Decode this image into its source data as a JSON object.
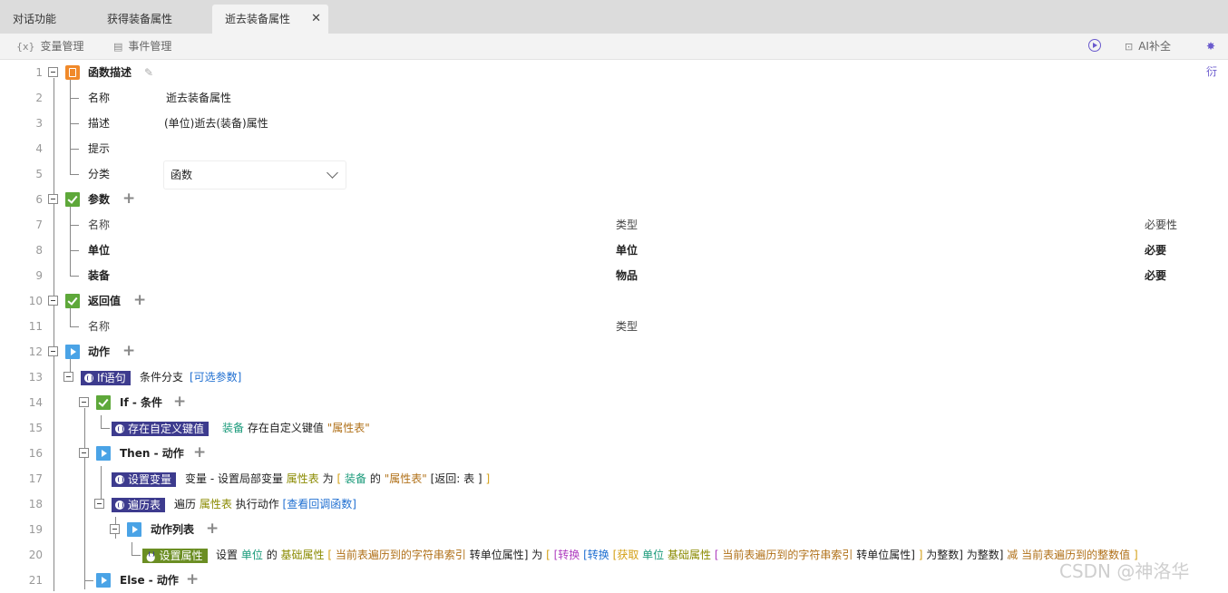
{
  "tabs": [
    "对话功能",
    "获得装备属性",
    "逝去装备属性"
  ],
  "tab_close": "✕",
  "toolbar": {
    "var_icon": "{x}",
    "var_label": "变量管理",
    "event_label": "事件管理",
    "ai_label": "AI补全",
    "cut_label": "衍"
  },
  "lines": [
    "1",
    "2",
    "3",
    "4",
    "5",
    "6",
    "7",
    "8",
    "9",
    "10",
    "11",
    "12",
    "13",
    "14",
    "15",
    "16",
    "17",
    "18",
    "19",
    "20",
    "21"
  ],
  "desc": {
    "header": "函数描述",
    "name_label": "名称",
    "name_value": "逝去装备属性",
    "desc_label": "描述",
    "desc_value": "(单位)逝去(装备)属性",
    "hint_label": "提示",
    "category_label": "分类",
    "category_value": "函数"
  },
  "params": {
    "header": "参数",
    "col_name": "名称",
    "col_type": "类型",
    "col_required": "必要性",
    "rows": [
      {
        "name": "单位",
        "type": "单位",
        "required": "必要"
      },
      {
        "name": "装备",
        "type": "物品",
        "required": "必要"
      }
    ]
  },
  "returns": {
    "header": "返回值",
    "col_name": "名称",
    "col_type": "类型"
  },
  "actions": {
    "header": "动作",
    "if_badge": "If语句",
    "if_desc": "条件分支",
    "if_opt": "[可选参数]",
    "if_cond_header": "If - 条件",
    "exists_badge": "存在自定义键值",
    "exists_t1": "装备",
    "exists_t2": "存在自定义键值",
    "exists_t3": "\"属性表\"",
    "then_header": "Then - 动作",
    "setvar_badge": "设置变量",
    "setvar_t1": "变量 - 设置局部变量",
    "setvar_t2": "属性表",
    "setvar_t3": "为",
    "setvar_t4": "[",
    "setvar_t5": "装备",
    "setvar_t6": "的",
    "setvar_t7": "\"属性表\"",
    "setvar_t8": "[返回: 表 ]",
    "setvar_t9": "]",
    "loop_badge": "遍历表",
    "loop_t1": "遍历",
    "loop_t2": "属性表",
    "loop_t3": "执行动作",
    "loop_t4": "[查看回调函数]",
    "action_list_header": "动作列表",
    "setattr_badge": "设置属性",
    "setattr_t1": "设置",
    "setattr_t2": "单位",
    "setattr_t3": "的",
    "setattr_t4": "基础属性",
    "setattr_t5": "[",
    "setattr_t6": "当前表遍历到的字符串索引",
    "setattr_t7": "转单位属性]",
    "setattr_t8": "为",
    "setattr_t9": "[",
    "setattr_t10": "[转换",
    "setattr_t11": "[转换",
    "setattr_t12": "[获取",
    "setattr_t13": "单位",
    "setattr_t14": "基础属性",
    "setattr_t15": "[",
    "setattr_t16": "当前表遍历到的字符串索引",
    "setattr_t17": "转单位属性]",
    "setattr_t18": "]",
    "setattr_t19": "为整数]",
    "setattr_t20": "为整数]",
    "setattr_t21": "减",
    "setattr_t22": "当前表遍历到的整数值",
    "setattr_t23": "]",
    "else_header": "Else - 动作"
  },
  "watermark": "CSDN @神洛华",
  "colors": {
    "tabbar": "#dcdcdc",
    "badge_dark": "#3d3b8e",
    "badge_green": "#6b8e23",
    "link": "#1f6fd1",
    "teal": "#1a9a7a",
    "olive": "#8a8a00",
    "string": "#b07018"
  }
}
